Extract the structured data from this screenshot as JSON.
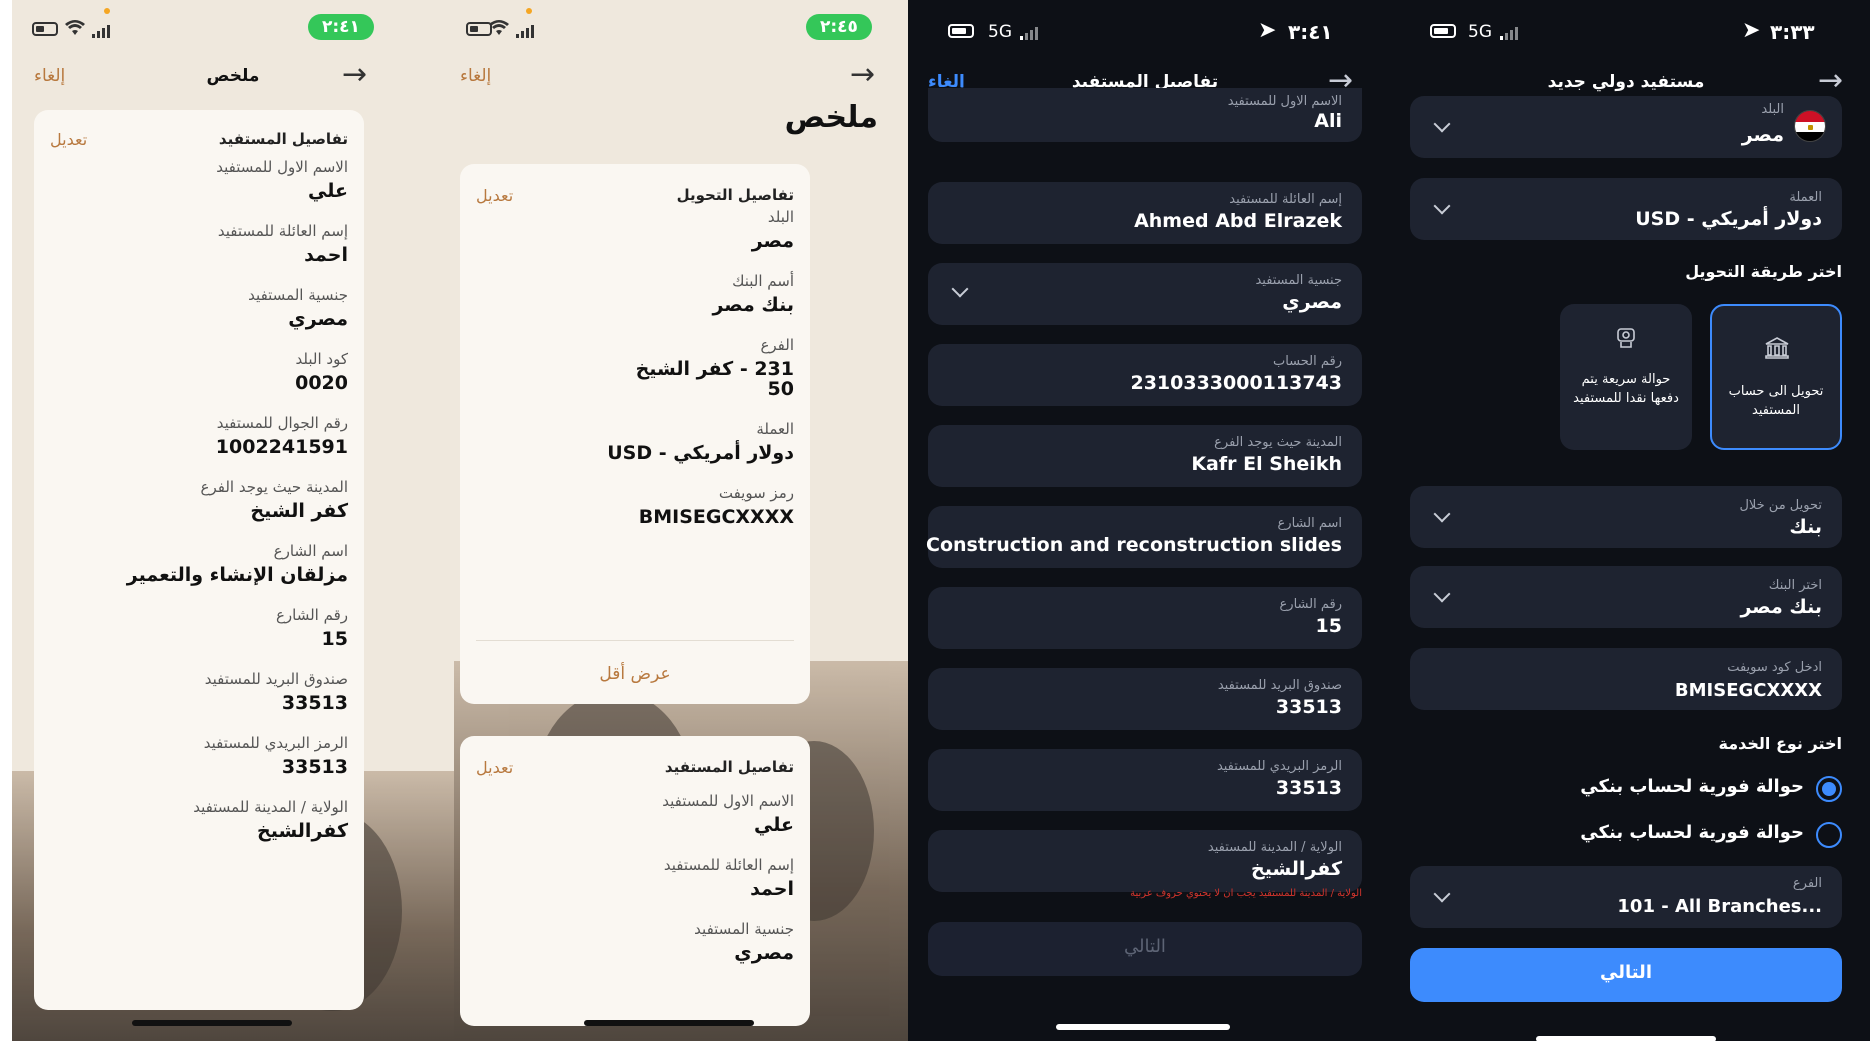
{
  "p1": {
    "time": "٢:٤١",
    "title": "ملخص",
    "cancel": "إلغاء",
    "card": {
      "heading": "تفاصيل المستفيد",
      "edit": "تعديل",
      "fields": [
        {
          "label": "الاسم الاول للمستفيد",
          "value": "علي"
        },
        {
          "label": "إسم العائلة للمستفيد",
          "value": "احمد"
        },
        {
          "label": "جنسية المستفيد",
          "value": "مصري"
        },
        {
          "label": "كود البلد",
          "value": "0020"
        },
        {
          "label": "رقم الجوال للمستفيد",
          "value": "1002241591"
        },
        {
          "label": "المدينة حيث يوجد الفرع",
          "value": "كفر الشيخ"
        },
        {
          "label": "اسم الشارع",
          "value": "مزلقان الإنشاء والتعمير"
        },
        {
          "label": "رقم الشارع",
          "value": "15"
        },
        {
          "label": "صندوق البريد للمستفيد",
          "value": "33513"
        },
        {
          "label": "الرمز البريدي للمستفيد",
          "value": "33513"
        },
        {
          "label": "الولاية / المدينة للمستفيد",
          "value": "كفرالشيخ"
        }
      ]
    }
  },
  "p2": {
    "time": "٢:٤٥",
    "title": "ملخص",
    "cancel": "إلغاء",
    "transfer": {
      "heading": "تفاصيل التحويل",
      "edit": "تعديل",
      "show_less": "عرض أقل",
      "fields": [
        {
          "label": "البلد",
          "value": "مصر"
        },
        {
          "label": "أسم البنك",
          "value": "بنك مصر"
        },
        {
          "label": "الفرع",
          "value": "231 - كفر الشيخ",
          "value2": "50"
        },
        {
          "label": "العملة",
          "value": "دولار أمريكي - USD"
        },
        {
          "label": "رمز سويفت",
          "value": "BMISEGCXXXX"
        }
      ]
    },
    "beneficiary": {
      "heading": "تفاصيل المستفيد",
      "edit": "تعديل",
      "fields": [
        {
          "label": "الاسم الاول للمستفيد",
          "value": "علي"
        },
        {
          "label": "إسم العائلة للمستفيد",
          "value": "احمد"
        },
        {
          "label": "جنسية المستفيد",
          "value": "مصري"
        }
      ]
    }
  },
  "p3": {
    "time": "٣:٤١",
    "network": "5G",
    "title": "تفاصيل المستفيد",
    "cancel": "إلغاء",
    "fields": [
      {
        "label": "الاسم الاول للمستفيد",
        "value": "Ali"
      },
      {
        "label": "إسم العائلة للمستفيد",
        "value": "Ahmed Abd Elrazek"
      },
      {
        "label": "جنسية المستفيد",
        "value": "مصري"
      },
      {
        "label": "رقم الحساب",
        "value": "2310333000113743"
      },
      {
        "label": "المدينة حيث يوجد الفرع",
        "value": "Kafr El Sheikh"
      },
      {
        "label": "اسم الشارع",
        "value": "Construction and reconstruction slides"
      },
      {
        "label": "رقم الشارع",
        "value": "15"
      },
      {
        "label": "صندوق البريد للمستفيد",
        "value": "33513"
      },
      {
        "label": "الرمز البريدي للمستفيد",
        "value": "33513"
      },
      {
        "label": "الولاية / المدينة للمستفيد",
        "value": "كفرالشيخ"
      }
    ],
    "error": "الولاية / المدينة للمستفيد يجب ان لا يحتوي حروف عربية",
    "next": "التالي"
  },
  "p4": {
    "time": "٣:٣٣",
    "network": "5G",
    "title": "مستفيد دولي جديد",
    "country": {
      "label": "البلد",
      "value": "مصر"
    },
    "currency": {
      "label": "العملة",
      "value": "دولار أمريكي - USD"
    },
    "method_title": "اختر طريقة التحويل",
    "method_account": "تحويل الى حساب المستفيد",
    "method_cash": "حوالة سريعة يتم دفعها نقدا للمستفيد",
    "via": {
      "label": "تحويل من خلال",
      "value": "بنك"
    },
    "bank": {
      "label": "اختر البنك",
      "value": "بنك مصر"
    },
    "swift": {
      "label": "ادخل كود سويفت",
      "value": "BMISEGCXXXX"
    },
    "service_title": "اختر نوع الخدمة",
    "service_1": "حوالة فورية لحساب بنكي",
    "service_2": "حوالة فورية لحساب بنكي",
    "branch": {
      "label": "الفرع",
      "value": "101 - All Branches..."
    },
    "next": "التالي"
  },
  "colors": {
    "gold": "#b8793f",
    "blue": "#3d8bfd",
    "dark_bg": "#0d1016",
    "field_bg": "#1e2330",
    "green": "#34c759"
  }
}
